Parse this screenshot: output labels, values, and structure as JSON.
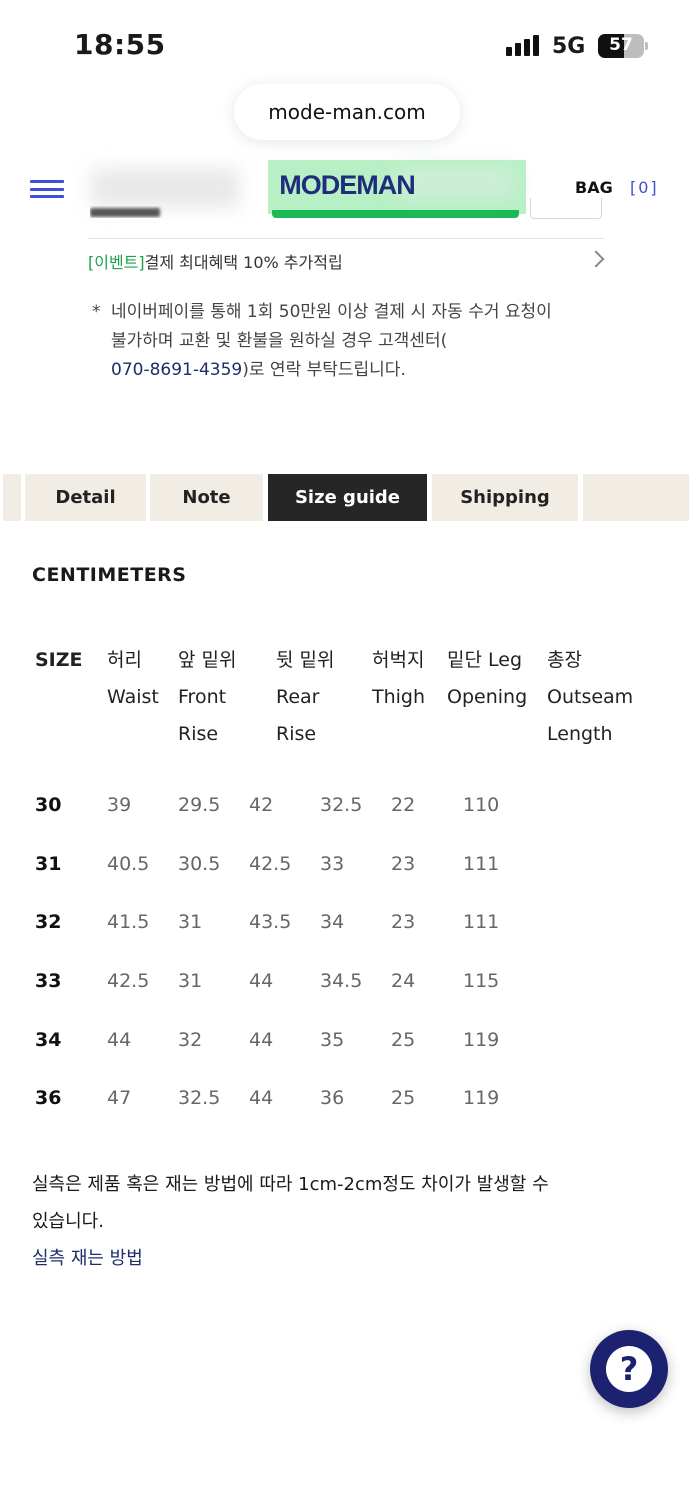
{
  "status_bar": {
    "time": "18:55",
    "network": "5G",
    "battery": "57"
  },
  "browser": {
    "url": "mode-man.com"
  },
  "header": {
    "logo": "MODEMAN",
    "bag_label": "BAG",
    "bag_count": "[0]"
  },
  "event": {
    "tag": "[이벤트]",
    "text": "결제 최대혜택 10% 추가적립"
  },
  "notice": {
    "star": "*",
    "text_line1": "네이버페이를 통해 1회 50만원 이상 결제 시 자동 수거 요청이",
    "text_line2": "불가하며 교환 및 환불을 원하실 경우 고객센터(",
    "phone": "070-8691-4359",
    "text_tail": ")로 연락 부탁드립니다."
  },
  "tabs": [
    {
      "label": "Detail",
      "active": false
    },
    {
      "label": "Note",
      "active": false
    },
    {
      "label": "Size guide",
      "active": true
    },
    {
      "label": "Shipping",
      "active": false
    }
  ],
  "size_guide": {
    "unit": "CENTIMETERS",
    "headers": [
      {
        "ko": "SIZE",
        "en": "",
        "en2": ""
      },
      {
        "ko": "허리",
        "en": "Waist",
        "en2": ""
      },
      {
        "ko": "앞 밑위",
        "en": "Front",
        "en2": "Rise"
      },
      {
        "ko": "뒷 밑위",
        "en": "Rear",
        "en2": "Rise"
      },
      {
        "ko": "허벅지",
        "en": "Thigh",
        "en2": ""
      },
      {
        "ko": "밑단 Leg",
        "en": "Opening",
        "en2": ""
      },
      {
        "ko": "총장",
        "en": "Outseam",
        "en2": "Length"
      }
    ],
    "rows": [
      [
        "30",
        "39",
        "29.5",
        "42",
        "32.5",
        "22",
        "110"
      ],
      [
        "31",
        "40.5",
        "30.5",
        "42.5",
        "33",
        "23",
        "111"
      ],
      [
        "32",
        "41.5",
        "31",
        "43.5",
        "34",
        "23",
        "111"
      ],
      [
        "33",
        "42.5",
        "31",
        "44",
        "34.5",
        "24",
        "115"
      ],
      [
        "34",
        "44",
        "32",
        "44",
        "35",
        "25",
        "119"
      ],
      [
        "36",
        "47",
        "32.5",
        "44",
        "36",
        "25",
        "119"
      ]
    ],
    "note_line1": "실측은 제품 혹은 재는 방법에 따라 1cm-2cm정도 차이가 발생할 수",
    "note_line2": "있습니다.",
    "howto_link": "실측 재는 방법"
  },
  "help_button": {
    "label": "?"
  },
  "colors": {
    "accent": "#3f4fd6",
    "brand": "#1f2d7a",
    "event_green": "#1aa34a",
    "tab_bg": "#f1ede5",
    "tab_active": "#262626",
    "fab": "#1d2270"
  }
}
